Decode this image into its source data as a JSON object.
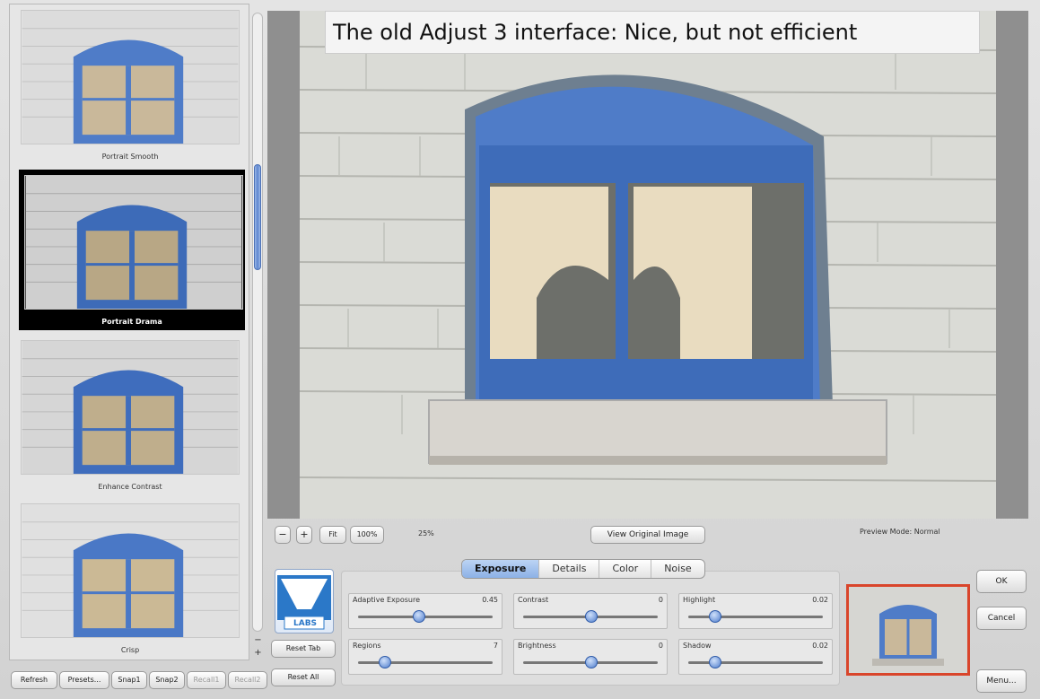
{
  "caption": "The old Adjust 3 interface: Nice, but not efficient",
  "presets": [
    {
      "label": "Portrait Smooth"
    },
    {
      "label": "Portrait Drama"
    },
    {
      "label": "Enhance Contrast"
    },
    {
      "label": "Crisp"
    }
  ],
  "bottom_buttons": [
    "Refresh",
    "Presets...",
    "Snap1",
    "Snap2",
    "Recall1",
    "Recall2"
  ],
  "zoom": {
    "minus": "−",
    "plus": "+",
    "fit": "Fit",
    "full": "100%",
    "zoom_level": "25%"
  },
  "view_original": "View Original Image",
  "preview_mode": "Preview Mode:  Normal",
  "tabs": [
    "Exposure",
    "Details",
    "Color",
    "Noise"
  ],
  "active_tab": "Exposure",
  "sliders": [
    {
      "name": "Adaptive Exposure",
      "value": "0.45",
      "level": 0.45
    },
    {
      "name": "Contrast",
      "value": "0",
      "level": 0.5
    },
    {
      "name": "Highlight",
      "value": "0.02",
      "level": 0.2
    },
    {
      "name": "Regions",
      "value": "7",
      "level": 0.2
    },
    {
      "name": "Brightness",
      "value": "0",
      "level": 0.5
    },
    {
      "name": "Shadow",
      "value": "0.02",
      "level": 0.2
    }
  ],
  "reset_tab": "Reset Tab",
  "reset_all": "Reset All",
  "logo_text": "LABS",
  "ok": "OK",
  "cancel": "Cancel",
  "menu": "Menu...",
  "colors": {
    "accent_blue": "#5d86cf",
    "highlight_red": "#d9452b",
    "window_blue": "#4f7cc8"
  }
}
